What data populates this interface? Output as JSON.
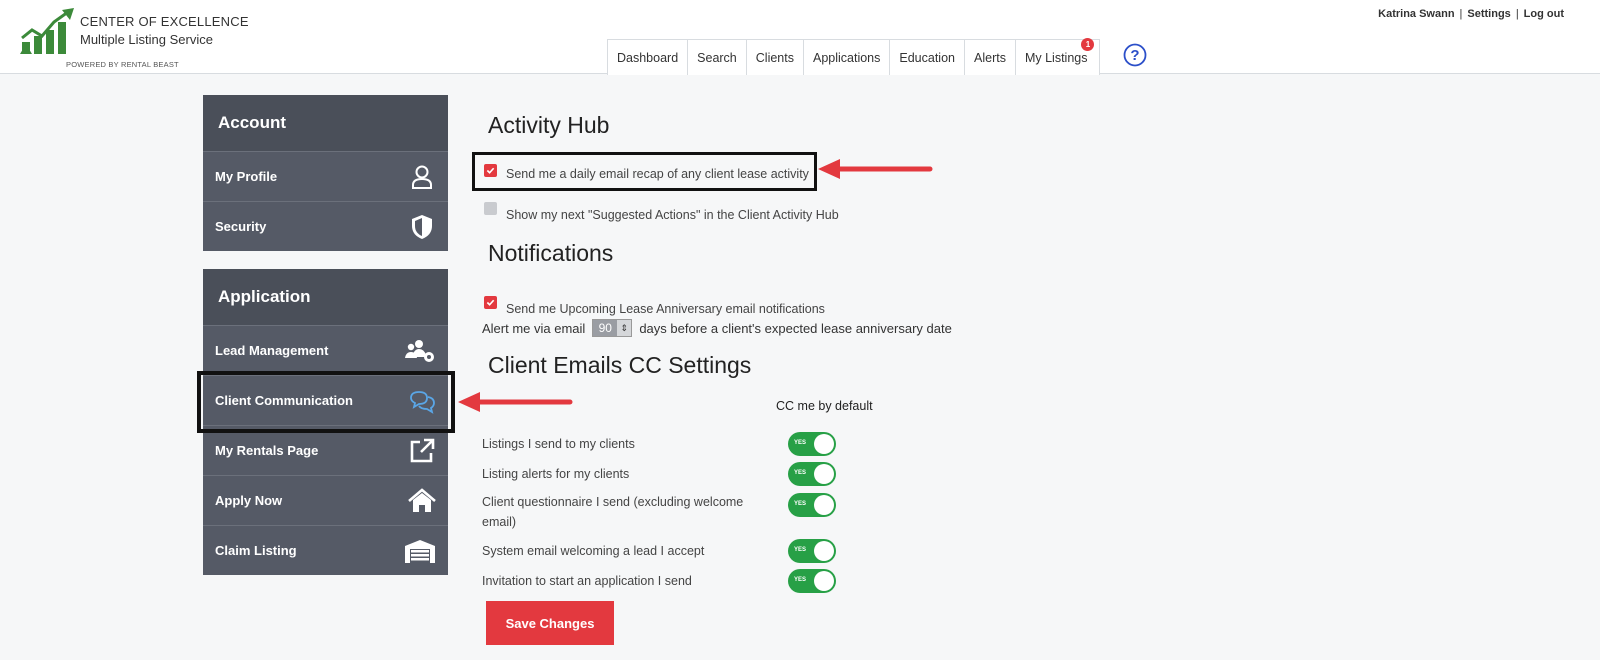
{
  "brand": {
    "line1": "CENTER OF EXCELLENCE",
    "line2": "Multiple Listing Service",
    "powered": "POWERED BY RENTAL BEAST",
    "green": "#3c8a3a"
  },
  "user": {
    "name": "Katrina Swann",
    "settings": "Settings",
    "logout": "Log out"
  },
  "nav": {
    "tabs": [
      {
        "label": "Dashboard"
      },
      {
        "label": "Search"
      },
      {
        "label": "Clients"
      },
      {
        "label": "Applications"
      },
      {
        "label": "Education"
      },
      {
        "label": "Alerts"
      },
      {
        "label": "My Listings",
        "badge": "1"
      }
    ],
    "help_icon": "question-circle-icon"
  },
  "sidebar": {
    "account": {
      "title": "Account",
      "items": [
        {
          "label": "My Profile",
          "icon": "user-icon"
        },
        {
          "label": "Security",
          "icon": "shield-icon"
        }
      ]
    },
    "application": {
      "title": "Application",
      "items": [
        {
          "label": "Lead Management",
          "icon": "users-gear-icon"
        },
        {
          "label": "Client Communication",
          "icon": "chat-bubbles-icon"
        },
        {
          "label": "My Rentals Page",
          "icon": "external-link-icon"
        },
        {
          "label": "Apply Now",
          "icon": "home-icon"
        },
        {
          "label": "Claim Listing",
          "icon": "warehouse-icon"
        }
      ]
    }
  },
  "activity_hub": {
    "title": "Activity Hub",
    "options": [
      {
        "label": "Send me a daily email recap of any client lease activity",
        "checked": true
      },
      {
        "label": "Show my next \"Suggested Actions\" in the Client Activity Hub",
        "checked": false
      }
    ]
  },
  "notifications": {
    "title": "Notifications",
    "option": {
      "label": "Send me Upcoming Lease Anniversary email notifications",
      "checked": true
    },
    "alert_prefix": "Alert me via email",
    "alert_days": "90",
    "alert_suffix": "days before a client's expected lease anniversary date"
  },
  "cc_settings": {
    "title": "Client Emails CC Settings",
    "column_header": "CC me by default",
    "toggle_text": "YES",
    "rows": [
      {
        "label": "Listings I send to my clients",
        "on": true
      },
      {
        "label": "Listing alerts for my clients",
        "on": true
      },
      {
        "label": "Client questionnaire I send (excluding welcome email)",
        "on": true
      },
      {
        "label": "System email welcoming a lead I accept",
        "on": true
      },
      {
        "label": "Invitation to start an application I send",
        "on": true
      }
    ]
  },
  "save_label": "Save Changes",
  "colors": {
    "accent": "#e3393f",
    "toggle_on": "#27a046",
    "sidebar": "#555a66",
    "sidebar_title": "#4a4f59"
  }
}
